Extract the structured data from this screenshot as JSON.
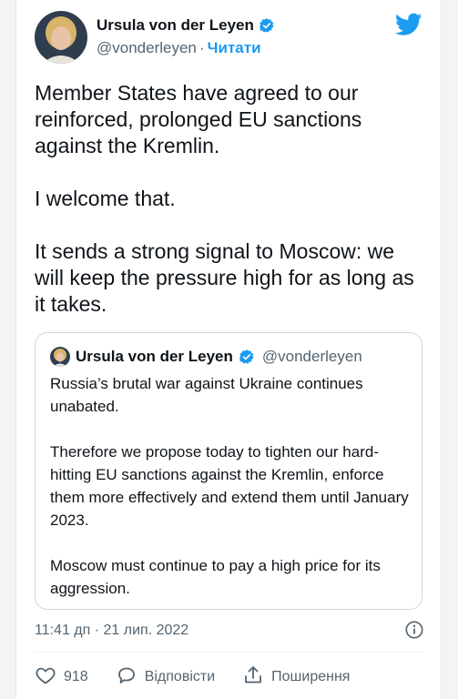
{
  "author": {
    "name": "Ursula von der Leyen",
    "handle": "@vonderleyen",
    "separator": "·",
    "follow_label": "Читати"
  },
  "tweet": {
    "paragraphs": [
      "Member States have agreed to our reinforced, prolonged EU sanctions against the Kremlin.",
      "I welcome that.",
      "It sends a strong signal to Moscow: we will keep the pressure high for as long as it takes."
    ]
  },
  "quoted": {
    "name": "Ursula von der Leyen",
    "handle": "@vonderleyen",
    "paragraphs": [
      "Russia’s brutal war against Ukraine continues unabated.",
      "Therefore we propose today to tighten our hard-hitting EU sanctions against the Kremlin, enforce them more effectively and extend them until January 2023.",
      "Moscow must continue to pay a high price for its aggression."
    ]
  },
  "meta": {
    "timestamp": "11:41 дп · 21 лип. 2022"
  },
  "actions": {
    "like_count": "918",
    "reply_label": "Відповісти",
    "share_label": "Поширення"
  },
  "icons": {
    "brand": "twitter-bird-icon",
    "verified": "verified-badge-icon",
    "info": "info-icon",
    "like": "heart-icon",
    "reply": "reply-bubble-icon",
    "share": "share-icon"
  },
  "colors": {
    "brand_blue": "#1d9bf0",
    "text": "#0f1419",
    "muted": "#536471",
    "border": "#cfd9de"
  }
}
